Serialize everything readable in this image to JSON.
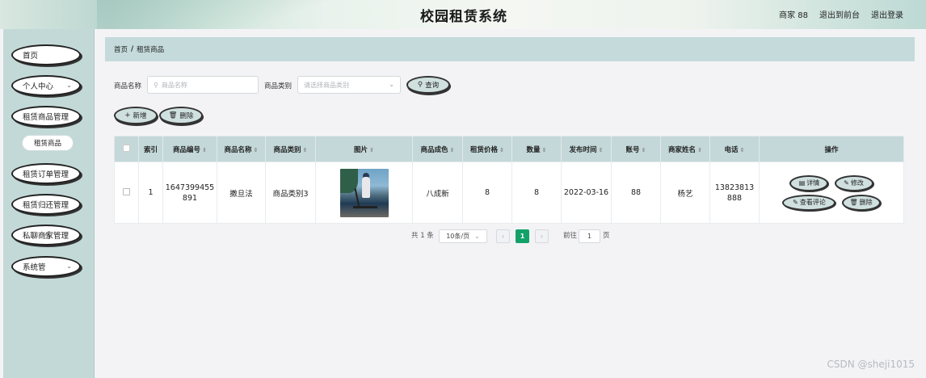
{
  "app": {
    "title": "校园租赁系统"
  },
  "header": {
    "user": "商家 88",
    "back_front": "退出到前台",
    "logout": "退出登录"
  },
  "sidebar": {
    "items": [
      {
        "label": "首页"
      },
      {
        "label": "个人中心"
      },
      {
        "label": "租赁商品管理"
      },
      {
        "label": "租赁订单管理"
      },
      {
        "label": "租赁归还管理"
      },
      {
        "label": "私聊商家管理"
      },
      {
        "label": "系统管"
      }
    ],
    "sub_item": "租赁商品"
  },
  "breadcrumb": {
    "home": "首页",
    "sep": "/",
    "current": "租赁商品"
  },
  "search": {
    "name_label": "商品名称",
    "name_placeholder": "商品名称",
    "category_label": "商品类别",
    "category_placeholder": "请选择商品类别",
    "query_label": "查询"
  },
  "actions": {
    "add": "新增",
    "delete": "删除"
  },
  "table": {
    "headers": [
      "索引",
      "商品编号",
      "商品名称",
      "商品类别",
      "图片",
      "商品成色",
      "租赁价格",
      "数量",
      "发布时间",
      "账号",
      "商家姓名",
      "电话",
      "操作"
    ],
    "rows": [
      {
        "index": "1",
        "code": "1647399455891",
        "name": "撒旦法",
        "category": "商品类别3",
        "condition": "八成新",
        "price": "8",
        "quantity": "8",
        "published": "2022-03-16",
        "account": "88",
        "merchant": "杨艺",
        "phone": "13823813888",
        "ops": {
          "detail": "详情",
          "edit": "修改",
          "review": "查看评论",
          "delete": "删除"
        }
      }
    ]
  },
  "pagination": {
    "total": "共 1 条",
    "page_size": "10条/页",
    "current_page": "1",
    "goto_prefix": "前往",
    "goto_value": "1",
    "goto_suffix": "页"
  },
  "watermark": "CSDN @sheji1015",
  "colors": {
    "primary": "#13a16a",
    "sidebar": "#c3d9d8",
    "header_row": "#c4d8d9"
  }
}
